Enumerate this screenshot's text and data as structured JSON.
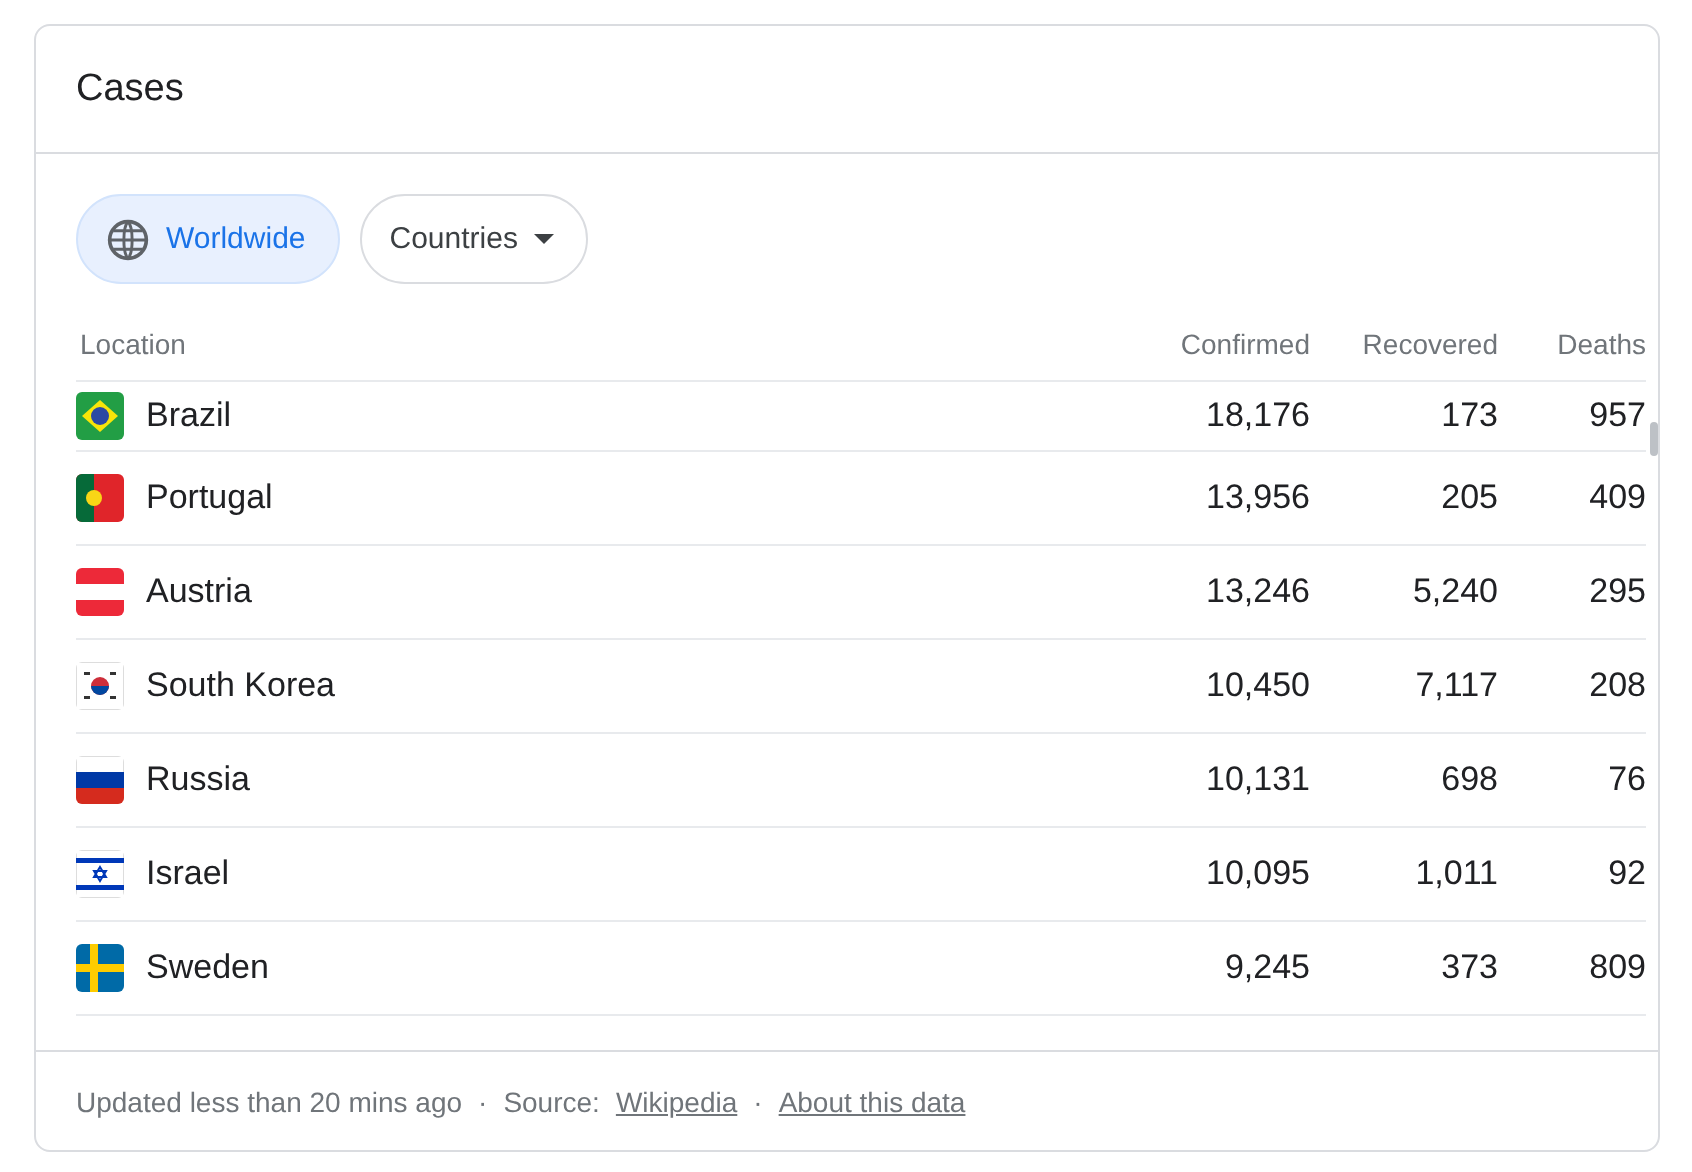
{
  "title": "Cases",
  "chips": [
    {
      "kind": "globe",
      "label": "Worldwide",
      "selected": true
    },
    {
      "kind": "dropdown",
      "label": "Countries",
      "selected": false
    }
  ],
  "table": {
    "columns": [
      "Location",
      "Confirmed",
      "Recovered",
      "Deaths"
    ],
    "rows": [
      {
        "kind": "br",
        "location": "Brazil",
        "confirmed": "18,176",
        "recovered": "173",
        "deaths": "957"
      },
      {
        "kind": "pt",
        "location": "Portugal",
        "confirmed": "13,956",
        "recovered": "205",
        "deaths": "409"
      },
      {
        "kind": "at",
        "location": "Austria",
        "confirmed": "13,246",
        "recovered": "5,240",
        "deaths": "295"
      },
      {
        "kind": "kr",
        "location": "South Korea",
        "confirmed": "10,450",
        "recovered": "7,117",
        "deaths": "208"
      },
      {
        "kind": "ru",
        "location": "Russia",
        "confirmed": "10,131",
        "recovered": "698",
        "deaths": "76"
      },
      {
        "kind": "il",
        "location": "Israel",
        "confirmed": "10,095",
        "recovered": "1,011",
        "deaths": "92"
      },
      {
        "kind": "se",
        "location": "Sweden",
        "confirmed": "9,245",
        "recovered": "373",
        "deaths": "809"
      }
    ]
  },
  "footer": {
    "updated": "Updated less than 20 mins ago",
    "separator": "·",
    "source_label": "Source:",
    "source_link": "Wikipedia",
    "about_link": "About this data"
  }
}
